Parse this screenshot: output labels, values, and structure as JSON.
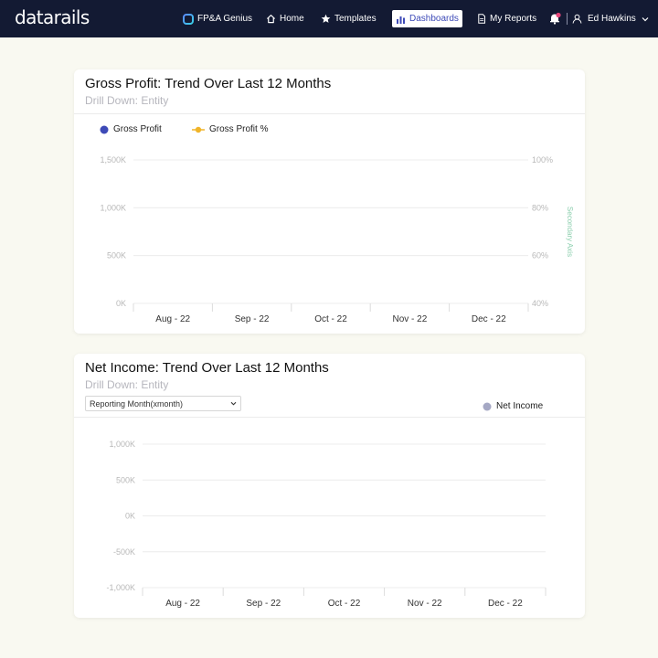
{
  "nav": {
    "logo": "datarails",
    "items": [
      {
        "label": "FP&A Genius",
        "icon": "genius-icon"
      },
      {
        "label": "Home",
        "icon": "home-icon"
      },
      {
        "label": "Templates",
        "icon": "star-icon"
      },
      {
        "label": "Dashboards",
        "icon": "bar-chart-icon",
        "active": true
      },
      {
        "label": "My Reports",
        "icon": "document-icon"
      }
    ],
    "user_name": "Ed Hawkins"
  },
  "gross_profit": {
    "title": "Gross Profit: Trend Over Last 12 Months",
    "subtitle": "Drill Down: Entity",
    "legend": [
      {
        "name": "Gross Profit",
        "color": "#3d4ab7"
      },
      {
        "name": "Gross Profit %",
        "color": "#f0b429"
      }
    ],
    "secondary_axis_label": "Secondary Axis"
  },
  "net_income": {
    "title": "Net Income: Trend Over Last 12 Months",
    "subtitle": "Drill Down: Entity",
    "dropdown_value": "Reporting Month(xmonth)",
    "legend": [
      {
        "name": "Net Income",
        "color": "#a5a8c4"
      }
    ]
  },
  "chart_data": [
    {
      "type": "bar",
      "title": "Gross Profit: Trend Over Last 12 Months",
      "categories": [
        "Aug - 22",
        "Sep - 22",
        "Oct - 22",
        "Nov - 22",
        "Dec - 22"
      ],
      "series": [
        {
          "name": "Gross Profit",
          "axis": "primary",
          "values": []
        },
        {
          "name": "Gross Profit %",
          "axis": "secondary",
          "values": []
        }
      ],
      "y_ticks": [
        "0K",
        "500K",
        "1,000K",
        "1,500K"
      ],
      "ylim": [
        0,
        1500000
      ],
      "y2_ticks": [
        "40%",
        "60%",
        "80%",
        "100%"
      ],
      "y2lim": [
        40,
        100
      ],
      "y2label": "Secondary Axis",
      "grid": true,
      "legend_position": "top-left"
    },
    {
      "type": "bar",
      "title": "Net Income: Trend Over Last 12 Months",
      "categories": [
        "Aug - 22",
        "Sep - 22",
        "Oct - 22",
        "Nov - 22",
        "Dec - 22"
      ],
      "series": [
        {
          "name": "Net Income",
          "values": []
        }
      ],
      "y_ticks": [
        "-1,000K",
        "-500K",
        "0K",
        "500K",
        "1,000K"
      ],
      "ylim": [
        -1000000,
        1000000
      ],
      "grid": true,
      "legend_position": "top-right"
    }
  ]
}
